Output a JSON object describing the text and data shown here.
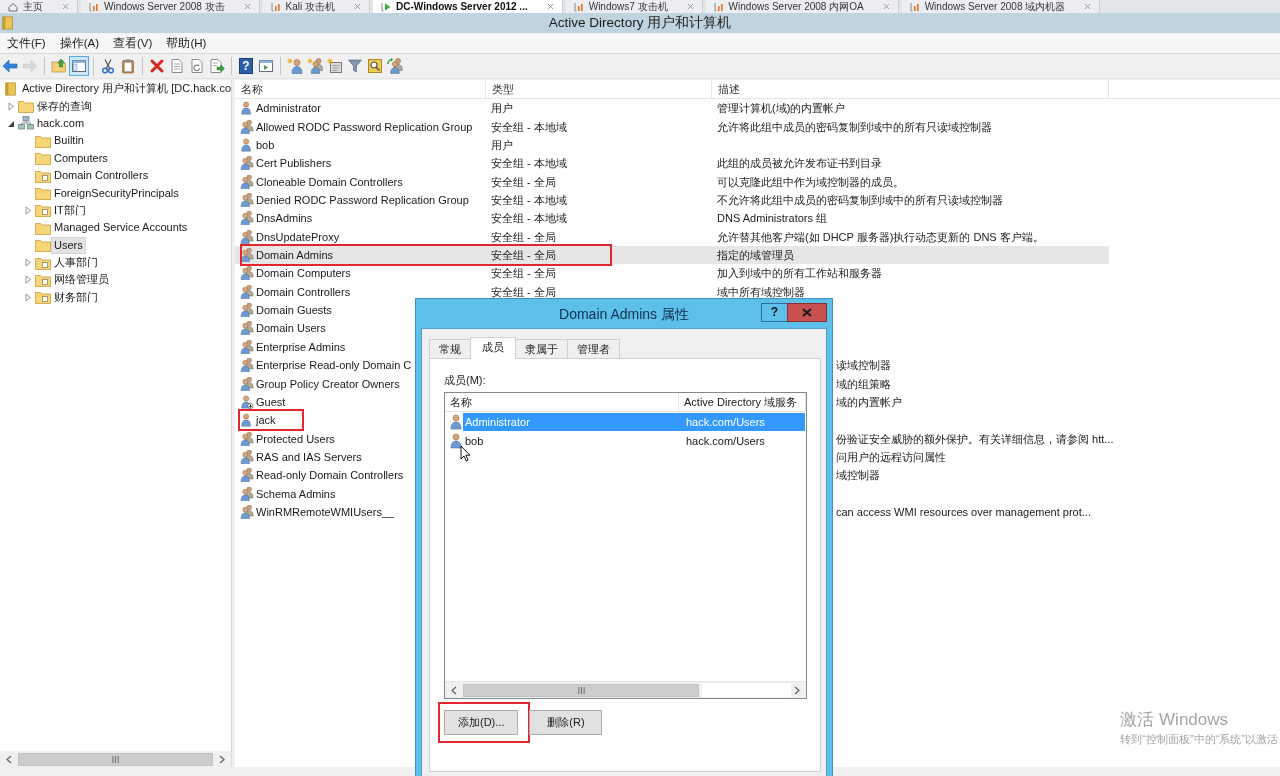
{
  "vm_tabs": [
    {
      "label": "主页",
      "kind": "home",
      "selected": false
    },
    {
      "label": "Windows Server 2008 攻击",
      "kind": "vm",
      "selected": false
    },
    {
      "label": "Kali 攻击机",
      "kind": "vm",
      "selected": false
    },
    {
      "label": "DC-Windows Server 2012 ...",
      "kind": "vm_running",
      "selected": true
    },
    {
      "label": "Windows7 攻击机",
      "kind": "vm",
      "selected": false
    },
    {
      "label": "Windows Server 2008 内网OA",
      "kind": "vm",
      "selected": false
    },
    {
      "label": "Windows Server 2008 域内机器",
      "kind": "vm",
      "selected": false
    }
  ],
  "window": {
    "title": "Active Directory 用户和计算机"
  },
  "menu": [
    "文件(F)",
    "操作(A)",
    "查看(V)",
    "帮助(H)"
  ],
  "toolbar": [
    [
      {
        "kind": "back",
        "disabled": false,
        "pressed": false
      },
      {
        "kind": "forward",
        "disabled": true,
        "pressed": false
      }
    ],
    [
      {
        "kind": "folder_up",
        "disabled": false,
        "pressed": false
      },
      {
        "kind": "console_tree",
        "disabled": false,
        "pressed": true
      }
    ],
    [
      {
        "kind": "cut",
        "disabled": false,
        "pressed": false
      },
      {
        "kind": "paste",
        "disabled": false,
        "pressed": false
      }
    ],
    [
      {
        "kind": "delete",
        "disabled": false,
        "pressed": false
      },
      {
        "kind": "properties",
        "disabled": false,
        "pressed": false
      },
      {
        "kind": "refresh",
        "disabled": false,
        "pressed": false
      },
      {
        "kind": "export",
        "disabled": false,
        "pressed": false
      }
    ],
    [
      {
        "kind": "help",
        "glyph": "?",
        "disabled": false,
        "pressed": false
      },
      {
        "kind": "action_pane",
        "disabled": false,
        "pressed": false
      }
    ],
    [
      {
        "kind": "new_user",
        "disabled": false,
        "pressed": false
      },
      {
        "kind": "new_group",
        "disabled": false,
        "pressed": false
      },
      {
        "kind": "new_ou",
        "disabled": false,
        "pressed": false
      },
      {
        "kind": "filter",
        "disabled": false,
        "pressed": false
      },
      {
        "kind": "find",
        "disabled": false,
        "pressed": false
      },
      {
        "kind": "add_to_group",
        "disabled": false,
        "pressed": false
      }
    ]
  ],
  "tree": [
    {
      "label": "Active Directory 用户和计算机 [DC.hack.co",
      "kind": "root",
      "selected": false,
      "children": [
        {
          "label": "保存的查询",
          "kind": "folder",
          "expanded": false,
          "selected": false
        },
        {
          "label": "hack.com",
          "kind": "domain",
          "expanded": true,
          "selected": false,
          "children": [
            {
              "label": "Builtin",
              "kind": "folder",
              "selected": false
            },
            {
              "label": "Computers",
              "kind": "folder",
              "selected": false
            },
            {
              "label": "Domain Controllers",
              "kind": "ou",
              "selected": false
            },
            {
              "label": "ForeignSecurityPrincipals",
              "kind": "folder",
              "selected": false
            },
            {
              "label": "IT部门",
              "kind": "ou",
              "expanded": false,
              "selected": false
            },
            {
              "label": "Managed Service Accounts",
              "kind": "folder",
              "selected": false
            },
            {
              "label": "Users",
              "kind": "folder",
              "selected": true
            },
            {
              "label": "人事部门",
              "kind": "ou",
              "expanded": false,
              "selected": false
            },
            {
              "label": "网络管理员",
              "kind": "ou",
              "expanded": false,
              "selected": false
            },
            {
              "label": "财务部门",
              "kind": "ou",
              "expanded": false,
              "selected": false
            }
          ]
        }
      ]
    }
  ],
  "list": {
    "columns": [
      "名称",
      "类型",
      "描述"
    ],
    "rows": [
      {
        "name": "Administrator",
        "kind": "user",
        "type": "用户",
        "description": "管理计算机(域)的内置帐户",
        "selected": false,
        "disabled": false,
        "annotated": false
      },
      {
        "name": "Allowed RODC Password Replication Group",
        "kind": "group",
        "type": "安全组 - 本地域",
        "description": "允许将此组中成员的密码复制到域中的所有只读域控制器",
        "selected": false,
        "disabled": false,
        "annotated": false
      },
      {
        "name": "bob",
        "kind": "user",
        "type": "用户",
        "selected": false,
        "disabled": false,
        "annotated": false
      },
      {
        "name": "Cert Publishers",
        "kind": "group",
        "type": "安全组 - 本地域",
        "description": "此组的成员被允许发布证书到目录",
        "selected": false,
        "disabled": false,
        "annotated": false
      },
      {
        "name": "Cloneable Domain Controllers",
        "kind": "group",
        "type": "安全组 - 全局",
        "description": "可以克隆此组中作为域控制器的成员。",
        "selected": false,
        "disabled": false,
        "annotated": false
      },
      {
        "name": "Denied RODC Password Replication Group",
        "kind": "group",
        "type": "安全组 - 本地域",
        "description": "不允许将此组中成员的密码复制到域中的所有只读域控制器",
        "selected": false,
        "disabled": false,
        "annotated": false
      },
      {
        "name": "DnsAdmins",
        "kind": "group",
        "type": "安全组 - 本地域",
        "description": "DNS Administrators 组",
        "selected": false,
        "disabled": false,
        "annotated": false
      },
      {
        "name": "DnsUpdateProxy",
        "kind": "group",
        "type": "安全组 - 全局",
        "description": "允许替其他客户端(如 DHCP 服务器)执行动态更新的 DNS 客户端。",
        "selected": false,
        "disabled": false,
        "annotated": false
      },
      {
        "name": "Domain Admins",
        "kind": "group",
        "type": "安全组 - 全局",
        "description": "指定的域管理员",
        "selected": true,
        "disabled": false,
        "annotated": true
      },
      {
        "name": "Domain Computers",
        "kind": "group",
        "type": "安全组 - 全局",
        "description": "加入到域中的所有工作站和服务器",
        "selected": false,
        "disabled": false,
        "annotated": false
      },
      {
        "name": "Domain Controllers",
        "kind": "group",
        "type": "安全组 - 全局",
        "description": "域中所有域控制器",
        "selected": false,
        "disabled": false,
        "annotated": false
      },
      {
        "name": "Domain Guests",
        "kind": "group",
        "selected": false,
        "disabled": false,
        "annotated": false
      },
      {
        "name": "Domain Users",
        "kind": "group",
        "selected": false,
        "disabled": false,
        "annotated": false
      },
      {
        "name": "Enterprise Admins",
        "kind": "group",
        "selected": false,
        "disabled": false,
        "annotated": false
      },
      {
        "name": "Enterprise Read-only Domain C",
        "kind": "group",
        "description": "读域控制器",
        "selected": false,
        "disabled": false,
        "annotated": false
      },
      {
        "name": "Group Policy Creator Owners",
        "kind": "group",
        "description": "域的组策略",
        "selected": false,
        "disabled": false,
        "annotated": false
      },
      {
        "name": "Guest",
        "kind": "user",
        "description": "域的内置帐户",
        "selected": false,
        "disabled": true,
        "annotated": false
      },
      {
        "name": "jack",
        "kind": "user",
        "selected": false,
        "disabled": false,
        "annotated": true
      },
      {
        "name": "Protected Users",
        "kind": "group",
        "description": "份验证安全威胁的额外保护。有关详细信息，请参阅 htt...",
        "selected": false,
        "disabled": false,
        "annotated": false
      },
      {
        "name": "RAS and IAS Servers",
        "kind": "group",
        "description": "问用户的远程访问属性",
        "selected": false,
        "disabled": false,
        "annotated": false
      },
      {
        "name": "Read-only Domain Controllers",
        "kind": "group",
        "description": "域控制器",
        "selected": false,
        "disabled": false,
        "annotated": false
      },
      {
        "name": "Schema Admins",
        "kind": "group",
        "selected": false,
        "disabled": false,
        "annotated": false
      },
      {
        "name": "WinRMRemoteWMIUsers__",
        "kind": "group",
        "description": "can access WMI resources over management prot...",
        "selected": false,
        "disabled": false,
        "annotated": false
      }
    ]
  },
  "dialog": {
    "title": "Domain Admins 属性",
    "help_button": "?",
    "tabs": [
      {
        "label": "常规",
        "selected": false
      },
      {
        "label": "成员",
        "selected": true
      },
      {
        "label": "隶属于",
        "selected": false
      },
      {
        "label": "管理者",
        "selected": false
      }
    ],
    "members_label": "成员(M):",
    "members": {
      "columns": [
        "名称",
        "Active Directory 域服务"
      ],
      "rows": [
        {
          "name": "Administrator",
          "folder": "hack.com/Users",
          "selected": true
        },
        {
          "name": "bob",
          "folder": "hack.com/Users",
          "selected": false
        }
      ]
    },
    "buttons": [
      {
        "label": "添加(D)...",
        "annotated": true
      },
      {
        "label": "删除(R)",
        "annotated": false
      }
    ]
  },
  "activation_notice": {
    "title": "激活 Windows",
    "hint": "转到“控制面板”中的“系统”以激活"
  }
}
